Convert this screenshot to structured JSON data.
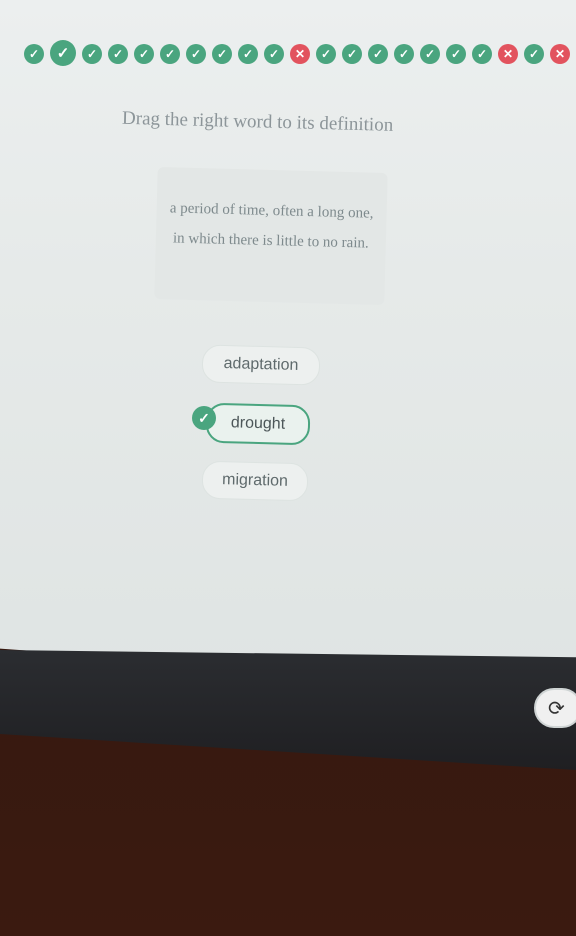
{
  "progress": {
    "items": [
      {
        "status": "correct",
        "icon": "check-icon",
        "glyph": "✓",
        "size": "small"
      },
      {
        "status": "correct",
        "icon": "check-icon",
        "glyph": "✓",
        "size": "big"
      },
      {
        "status": "correct",
        "icon": "check-icon",
        "glyph": "✓",
        "size": "small"
      },
      {
        "status": "correct",
        "icon": "check-icon",
        "glyph": "✓",
        "size": "small"
      },
      {
        "status": "correct",
        "icon": "check-icon",
        "glyph": "✓",
        "size": "small"
      },
      {
        "status": "correct",
        "icon": "check-icon",
        "glyph": "✓",
        "size": "small"
      },
      {
        "status": "correct",
        "icon": "check-icon",
        "glyph": "✓",
        "size": "small"
      },
      {
        "status": "correct",
        "icon": "check-icon",
        "glyph": "✓",
        "size": "small"
      },
      {
        "status": "correct",
        "icon": "check-icon",
        "glyph": "✓",
        "size": "small"
      },
      {
        "status": "correct",
        "icon": "check-icon",
        "glyph": "✓",
        "size": "small"
      },
      {
        "status": "wrong",
        "icon": "x-icon",
        "glyph": "✕",
        "size": "small"
      },
      {
        "status": "correct",
        "icon": "check-icon",
        "glyph": "✓",
        "size": "small"
      },
      {
        "status": "correct",
        "icon": "check-icon",
        "glyph": "✓",
        "size": "small"
      },
      {
        "status": "correct",
        "icon": "check-icon",
        "glyph": "✓",
        "size": "small"
      },
      {
        "status": "correct",
        "icon": "check-icon",
        "glyph": "✓",
        "size": "small"
      },
      {
        "status": "correct",
        "icon": "check-icon",
        "glyph": "✓",
        "size": "small"
      },
      {
        "status": "correct",
        "icon": "check-icon",
        "glyph": "✓",
        "size": "small"
      },
      {
        "status": "correct",
        "icon": "check-icon",
        "glyph": "✓",
        "size": "small"
      },
      {
        "status": "wrong",
        "icon": "x-icon",
        "glyph": "✕",
        "size": "small"
      },
      {
        "status": "correct",
        "icon": "check-icon",
        "glyph": "✓",
        "size": "small"
      },
      {
        "status": "wrong",
        "icon": "x-icon",
        "glyph": "✕",
        "size": "small"
      }
    ],
    "colors": {
      "correct": "#4aa57f",
      "wrong": "#e2535e"
    }
  },
  "exercise": {
    "instruction": "Drag the right word to its definition",
    "definition": "a period of time, often a long one, in which there is little to no rain."
  },
  "options": [
    {
      "label": "adaptation",
      "selected": false
    },
    {
      "label": "drought",
      "selected": true
    },
    {
      "label": "migration",
      "selected": false
    }
  ],
  "selected_check_icon": {
    "icon": "check-icon",
    "glyph": "✓"
  },
  "refresh_button": {
    "icon": "refresh-icon",
    "glyph": "⟳"
  }
}
